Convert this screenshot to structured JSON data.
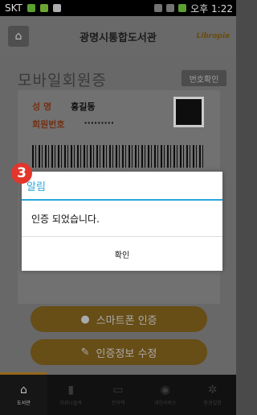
{
  "status": {
    "carrier": "SKT",
    "time": "오후 1:22"
  },
  "header": {
    "title": "광명시통합도서관",
    "brand": "Libropia"
  },
  "card": {
    "title": "모바일회원증",
    "number_button": "번호확인",
    "name_label": "성 명",
    "name_value": "홍길동",
    "id_label": "회원번호",
    "id_value": "·········"
  },
  "buttons": {
    "smartphone_auth": "스마트폰 인증",
    "edit_auth": "인증정보 수정"
  },
  "dialog": {
    "title": "알림",
    "message": "인증 되었습니다.",
    "ok": "확인"
  },
  "step_badge": "3",
  "tabs": [
    {
      "label": "도서관",
      "icon": "library-icon"
    },
    {
      "label": "자료나들목",
      "icon": "book-icon"
    },
    {
      "label": "전자책",
      "icon": "monitor-icon"
    },
    {
      "label": "개인서비스",
      "icon": "person-icon"
    },
    {
      "label": "환경설정",
      "icon": "gear-icon"
    }
  ]
}
